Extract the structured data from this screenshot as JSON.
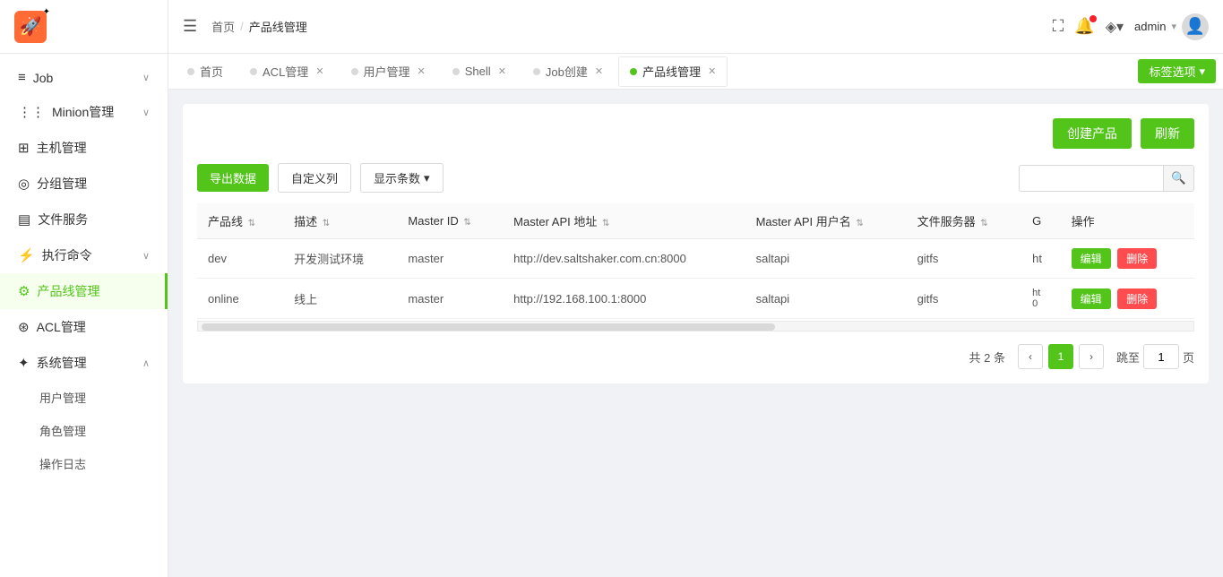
{
  "app": {
    "logo": "🚀",
    "logo_spark": "✦"
  },
  "sidebar": {
    "items": [
      {
        "id": "job",
        "icon": "≡",
        "label": "Job",
        "has_arrow": true,
        "active": false
      },
      {
        "id": "minion",
        "icon": "⋮⋮",
        "label": "Minion管理",
        "has_arrow": true,
        "active": false
      },
      {
        "id": "host",
        "icon": "⊞",
        "label": "主机管理",
        "has_arrow": false,
        "active": false
      },
      {
        "id": "group",
        "icon": "◎",
        "label": "分组管理",
        "has_arrow": false,
        "active": false
      },
      {
        "id": "file",
        "icon": "▤",
        "label": "文件服务",
        "has_arrow": false,
        "active": false
      },
      {
        "id": "exec",
        "icon": "⚡",
        "label": "执行命令",
        "has_arrow": true,
        "active": false
      },
      {
        "id": "product",
        "icon": "⚙",
        "label": "产品线管理",
        "has_arrow": false,
        "active": true
      },
      {
        "id": "acl",
        "icon": "⊛",
        "label": "ACL管理",
        "has_arrow": false,
        "active": false
      },
      {
        "id": "system",
        "icon": "✦",
        "label": "系统管理",
        "has_arrow": true,
        "active": false,
        "expanded": true
      }
    ],
    "sub_items": [
      {
        "id": "user-mgmt",
        "label": "用户管理"
      },
      {
        "id": "role-mgmt",
        "label": "角色管理"
      },
      {
        "id": "op-log",
        "label": "操作日志"
      }
    ]
  },
  "header": {
    "breadcrumb_home": "首页",
    "breadcrumb_sep": "/",
    "breadcrumb_current": "产品线管理",
    "user": "admin",
    "icons": {
      "fullscreen": "⛶",
      "notification": "🔔",
      "settings": "◈"
    }
  },
  "tabs": [
    {
      "id": "home",
      "label": "首页",
      "closable": false,
      "dot_color": "gray"
    },
    {
      "id": "acl",
      "label": "ACL管理",
      "closable": true,
      "dot_color": "gray"
    },
    {
      "id": "user",
      "label": "用户管理",
      "closable": true,
      "dot_color": "gray"
    },
    {
      "id": "shell",
      "label": "Shell",
      "closable": true,
      "dot_color": "gray"
    },
    {
      "id": "job-create",
      "label": "Job创建",
      "closable": true,
      "dot_color": "gray"
    },
    {
      "id": "product-line",
      "label": "产品线管理",
      "closable": true,
      "dot_color": "green",
      "active": true
    }
  ],
  "tabs_extra": {
    "tag_select": "标签选项",
    "tag_arrow": "▾"
  },
  "toolbar": {
    "export_label": "导出数据",
    "custom_col_label": "自定义列",
    "show_rows_label": "显示条数",
    "show_rows_arrow": "▾",
    "search_placeholder": ""
  },
  "content": {
    "create_btn": "创建产品",
    "refresh_btn": "刷新",
    "table": {
      "columns": [
        {
          "id": "product",
          "label": "产品线"
        },
        {
          "id": "desc",
          "label": "描述"
        },
        {
          "id": "master_id",
          "label": "Master ID"
        },
        {
          "id": "master_api",
          "label": "Master API 地址"
        },
        {
          "id": "master_user",
          "label": "Master API 用户名"
        },
        {
          "id": "file_server",
          "label": "文件服务器"
        },
        {
          "id": "g",
          "label": "G"
        },
        {
          "id": "action",
          "label": "操作"
        }
      ],
      "rows": [
        {
          "product": "dev",
          "desc": "开发测试环境",
          "master_id": "master",
          "master_api": "http://dev.saltshaker.com.cn:8000",
          "master_user": "saltapi",
          "file_server": "gitfs",
          "g": "ht",
          "edit_label": "编辑",
          "delete_label": "删除"
        },
        {
          "product": "online",
          "desc": "线上",
          "master_id": "master",
          "master_api": "http://192.168.100.1:8000",
          "master_user": "saltapi",
          "file_server": "gitfs",
          "g": "ht\n0",
          "edit_label": "编辑",
          "delete_label": "删除"
        }
      ]
    },
    "pagination": {
      "total_prefix": "共",
      "total_value": "2",
      "total_suffix": "条",
      "page_current": "1",
      "jump_label": "跳至",
      "jump_value": "1",
      "page_suffix": "页"
    }
  }
}
